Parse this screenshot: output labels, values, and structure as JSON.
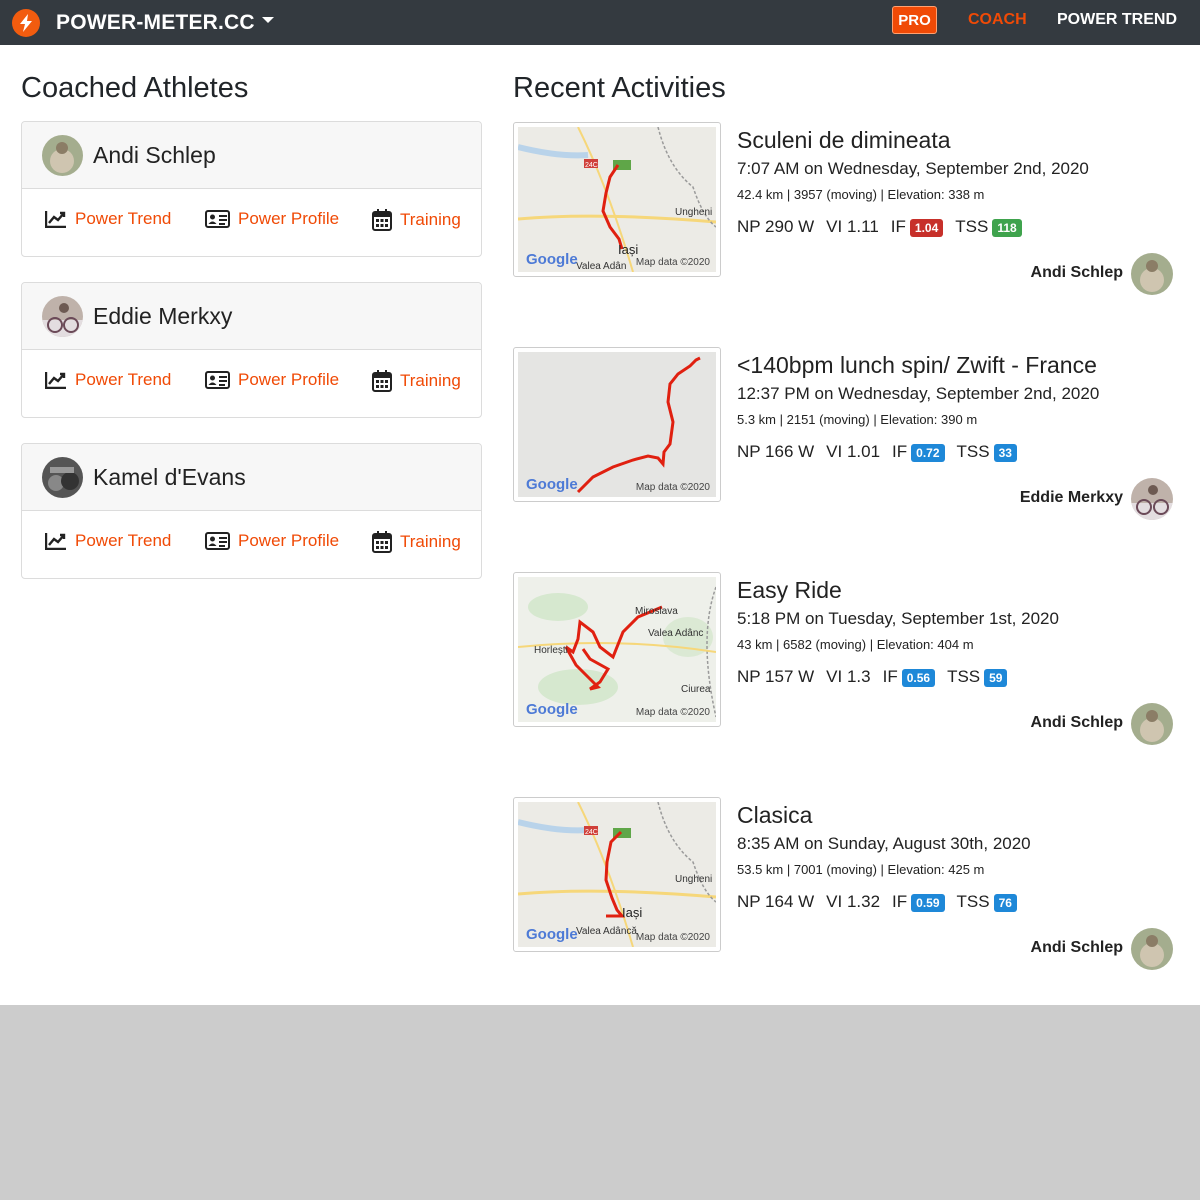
{
  "navbar": {
    "brand": "POWER-METER.CC",
    "pro": "PRO",
    "coach": "COACH",
    "power_trend": "POWER TREND",
    "logo_icon": "lightning-bolt-icon",
    "colors": {
      "bar": "#343a40",
      "accent": "#f04a06"
    }
  },
  "athletes_section": {
    "title": "Coached Athletes",
    "athletes": [
      {
        "name": "Andi Schlep",
        "links": [
          "Power Trend",
          "Power Profile",
          "Training"
        ]
      },
      {
        "name": "Eddie Merkxy",
        "links": [
          "Power Trend",
          "Power Profile",
          "Training"
        ]
      },
      {
        "name": "Kamel d'Evans",
        "links": [
          "Power Trend",
          "Power Profile",
          "Training"
        ]
      }
    ]
  },
  "activities_section": {
    "title": "Recent Activities",
    "activities": [
      {
        "title": "Sculeni de dimineata",
        "time": "7:07 AM on Wednesday, September 2nd, 2020",
        "meta": "42.4 km | 3957 (moving) | Elevation: 338 m",
        "np": "NP 290 W",
        "vi": "VI 1.11",
        "if_label": "IF",
        "if_value": "1.04",
        "if_color": "red",
        "tss_label": "TSS",
        "tss_value": "118",
        "tss_color": "green",
        "athlete": "Andi Schlep",
        "map": {
          "google": "Google",
          "credit": "Map data ©2020",
          "place1": "Iași",
          "place2": "Ungheni",
          "place3": "Valea Adân",
          "road": "24C"
        }
      },
      {
        "title": "<140bpm lunch spin/ Zwift - France",
        "time": "12:37 PM on Wednesday, September 2nd, 2020",
        "meta": "5.3 km | 2151 (moving) | Elevation: 390 m",
        "np": "NP 166 W",
        "vi": "VI 1.01",
        "if_label": "IF",
        "if_value": "0.72",
        "if_color": "blue",
        "tss_label": "TSS",
        "tss_value": "33",
        "tss_color": "blue",
        "athlete": "Eddie Merkxy",
        "map": {
          "google": "Google",
          "credit": "Map data ©2020"
        }
      },
      {
        "title": "Easy Ride",
        "time": "5:18 PM on Tuesday, September 1st, 2020",
        "meta": "43 km | 6582 (moving) | Elevation: 404 m",
        "np": "NP 157 W",
        "vi": "VI 1.3",
        "if_label": "IF",
        "if_value": "0.56",
        "if_color": "blue",
        "tss_label": "TSS",
        "tss_value": "59",
        "tss_color": "blue",
        "athlete": "Andi Schlep",
        "map": {
          "google": "Google",
          "credit": "Map data ©2020",
          "place1": "Miroslava",
          "place2": "Valea Adânc",
          "place3": "Horlești",
          "place4": "Ciurea"
        }
      },
      {
        "title": "Clasica",
        "time": "8:35 AM on Sunday, August 30th, 2020",
        "meta": "53.5 km | 7001 (moving) | Elevation: 425 m",
        "np": "NP 164 W",
        "vi": "VI 1.32",
        "if_label": "IF",
        "if_value": "0.59",
        "if_color": "blue",
        "tss_label": "TSS",
        "tss_value": "76",
        "tss_color": "blue",
        "athlete": "Andi Schlep",
        "map": {
          "google": "Google",
          "credit": "Map data ©2020",
          "place1": "Iași",
          "place2": "Ungheni",
          "place3": "Valea Adâncă",
          "road": "24C"
        }
      }
    ]
  }
}
